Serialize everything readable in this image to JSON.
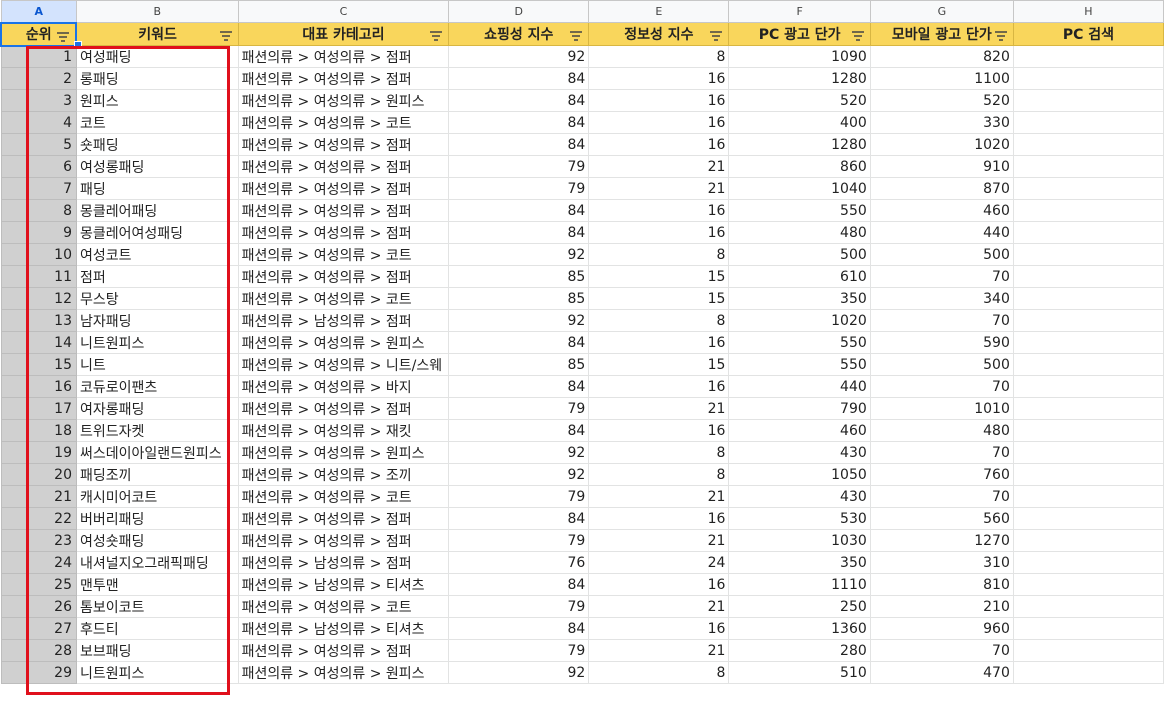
{
  "column_letters": [
    "A",
    "B",
    "C",
    "D",
    "E",
    "F",
    "G",
    "H"
  ],
  "headers": [
    "순위",
    "키워드",
    "대표 카테고리",
    "쇼핑성 지수",
    "정보성 지수",
    "PC 광고 단가",
    "모바일 광고 단가",
    "PC 검색"
  ],
  "rows": [
    {
      "rank": "1",
      "kw": "여성패딩",
      "cat": "패션의류 > 여성의류 > 점퍼",
      "shop": "92",
      "info": "8",
      "pc": "1090",
      "mob": "820"
    },
    {
      "rank": "2",
      "kw": "롱패딩",
      "cat": "패션의류 > 여성의류 > 점퍼",
      "shop": "84",
      "info": "16",
      "pc": "1280",
      "mob": "1100"
    },
    {
      "rank": "3",
      "kw": "원피스",
      "cat": "패션의류 > 여성의류 > 원피스",
      "shop": "84",
      "info": "16",
      "pc": "520",
      "mob": "520"
    },
    {
      "rank": "4",
      "kw": "코트",
      "cat": "패션의류 > 여성의류 > 코트",
      "shop": "84",
      "info": "16",
      "pc": "400",
      "mob": "330"
    },
    {
      "rank": "5",
      "kw": "숏패딩",
      "cat": "패션의류 > 여성의류 > 점퍼",
      "shop": "84",
      "info": "16",
      "pc": "1280",
      "mob": "1020"
    },
    {
      "rank": "6",
      "kw": "여성롱패딩",
      "cat": "패션의류 > 여성의류 > 점퍼",
      "shop": "79",
      "info": "21",
      "pc": "860",
      "mob": "910"
    },
    {
      "rank": "7",
      "kw": "패딩",
      "cat": "패션의류 > 여성의류 > 점퍼",
      "shop": "79",
      "info": "21",
      "pc": "1040",
      "mob": "870"
    },
    {
      "rank": "8",
      "kw": "몽클레어패딩",
      "cat": "패션의류 > 여성의류 > 점퍼",
      "shop": "84",
      "info": "16",
      "pc": "550",
      "mob": "460"
    },
    {
      "rank": "9",
      "kw": "몽클레어여성패딩",
      "cat": "패션의류 > 여성의류 > 점퍼",
      "shop": "84",
      "info": "16",
      "pc": "480",
      "mob": "440"
    },
    {
      "rank": "10",
      "kw": "여성코트",
      "cat": "패션의류 > 여성의류 > 코트",
      "shop": "92",
      "info": "8",
      "pc": "500",
      "mob": "500"
    },
    {
      "rank": "11",
      "kw": "점퍼",
      "cat": "패션의류 > 여성의류 > 점퍼",
      "shop": "85",
      "info": "15",
      "pc": "610",
      "mob": "70"
    },
    {
      "rank": "12",
      "kw": "무스탕",
      "cat": "패션의류 > 여성의류 > 코트",
      "shop": "85",
      "info": "15",
      "pc": "350",
      "mob": "340"
    },
    {
      "rank": "13",
      "kw": "남자패딩",
      "cat": "패션의류 > 남성의류 > 점퍼",
      "shop": "92",
      "info": "8",
      "pc": "1020",
      "mob": "70"
    },
    {
      "rank": "14",
      "kw": "니트원피스",
      "cat": "패션의류 > 여성의류 > 원피스",
      "shop": "84",
      "info": "16",
      "pc": "550",
      "mob": "590"
    },
    {
      "rank": "15",
      "kw": "니트",
      "cat": "패션의류 > 여성의류 > 니트/스웨",
      "shop": "85",
      "info": "15",
      "pc": "550",
      "mob": "500"
    },
    {
      "rank": "16",
      "kw": "코듀로이팬츠",
      "cat": "패션의류 > 여성의류 > 바지",
      "shop": "84",
      "info": "16",
      "pc": "440",
      "mob": "70"
    },
    {
      "rank": "17",
      "kw": "여자롱패딩",
      "cat": "패션의류 > 여성의류 > 점퍼",
      "shop": "79",
      "info": "21",
      "pc": "790",
      "mob": "1010"
    },
    {
      "rank": "18",
      "kw": "트위드자켓",
      "cat": "패션의류 > 여성의류 > 재킷",
      "shop": "84",
      "info": "16",
      "pc": "460",
      "mob": "480"
    },
    {
      "rank": "19",
      "kw": "써스데이아일랜드원피스",
      "cat": "패션의류 > 여성의류 > 원피스",
      "shop": "92",
      "info": "8",
      "pc": "430",
      "mob": "70"
    },
    {
      "rank": "20",
      "kw": "패딩조끼",
      "cat": "패션의류 > 여성의류 > 조끼",
      "shop": "92",
      "info": "8",
      "pc": "1050",
      "mob": "760"
    },
    {
      "rank": "21",
      "kw": "캐시미어코트",
      "cat": "패션의류 > 여성의류 > 코트",
      "shop": "79",
      "info": "21",
      "pc": "430",
      "mob": "70"
    },
    {
      "rank": "22",
      "kw": "버버리패딩",
      "cat": "패션의류 > 여성의류 > 점퍼",
      "shop": "84",
      "info": "16",
      "pc": "530",
      "mob": "560"
    },
    {
      "rank": "23",
      "kw": "여성숏패딩",
      "cat": "패션의류 > 여성의류 > 점퍼",
      "shop": "79",
      "info": "21",
      "pc": "1030",
      "mob": "1270"
    },
    {
      "rank": "24",
      "kw": "내셔널지오그래픽패딩",
      "cat": "패션의류 > 남성의류 > 점퍼",
      "shop": "76",
      "info": "24",
      "pc": "350",
      "mob": "310"
    },
    {
      "rank": "25",
      "kw": "맨투맨",
      "cat": "패션의류 > 남성의류 > 티셔츠",
      "shop": "84",
      "info": "16",
      "pc": "1110",
      "mob": "810"
    },
    {
      "rank": "26",
      "kw": "톰보이코트",
      "cat": "패션의류 > 여성의류 > 코트",
      "shop": "79",
      "info": "21",
      "pc": "250",
      "mob": "210"
    },
    {
      "rank": "27",
      "kw": "후드티",
      "cat": "패션의류 > 남성의류 > 티셔츠",
      "shop": "84",
      "info": "16",
      "pc": "1360",
      "mob": "960"
    },
    {
      "rank": "28",
      "kw": "보브패딩",
      "cat": "패션의류 > 여성의류 > 점퍼",
      "shop": "79",
      "info": "21",
      "pc": "280",
      "mob": "70"
    },
    {
      "rank": "29",
      "kw": "니트원피스",
      "cat": "패션의류 > 여성의류 > 원피스",
      "shop": "92",
      "info": "8",
      "pc": "510",
      "mob": "470"
    }
  ],
  "colors": {
    "header_fill": "#f9d65c",
    "selection_box": "#e0101c",
    "active_cell_border": "#1a73e8",
    "rownum_fill": "#d0d0d0"
  }
}
